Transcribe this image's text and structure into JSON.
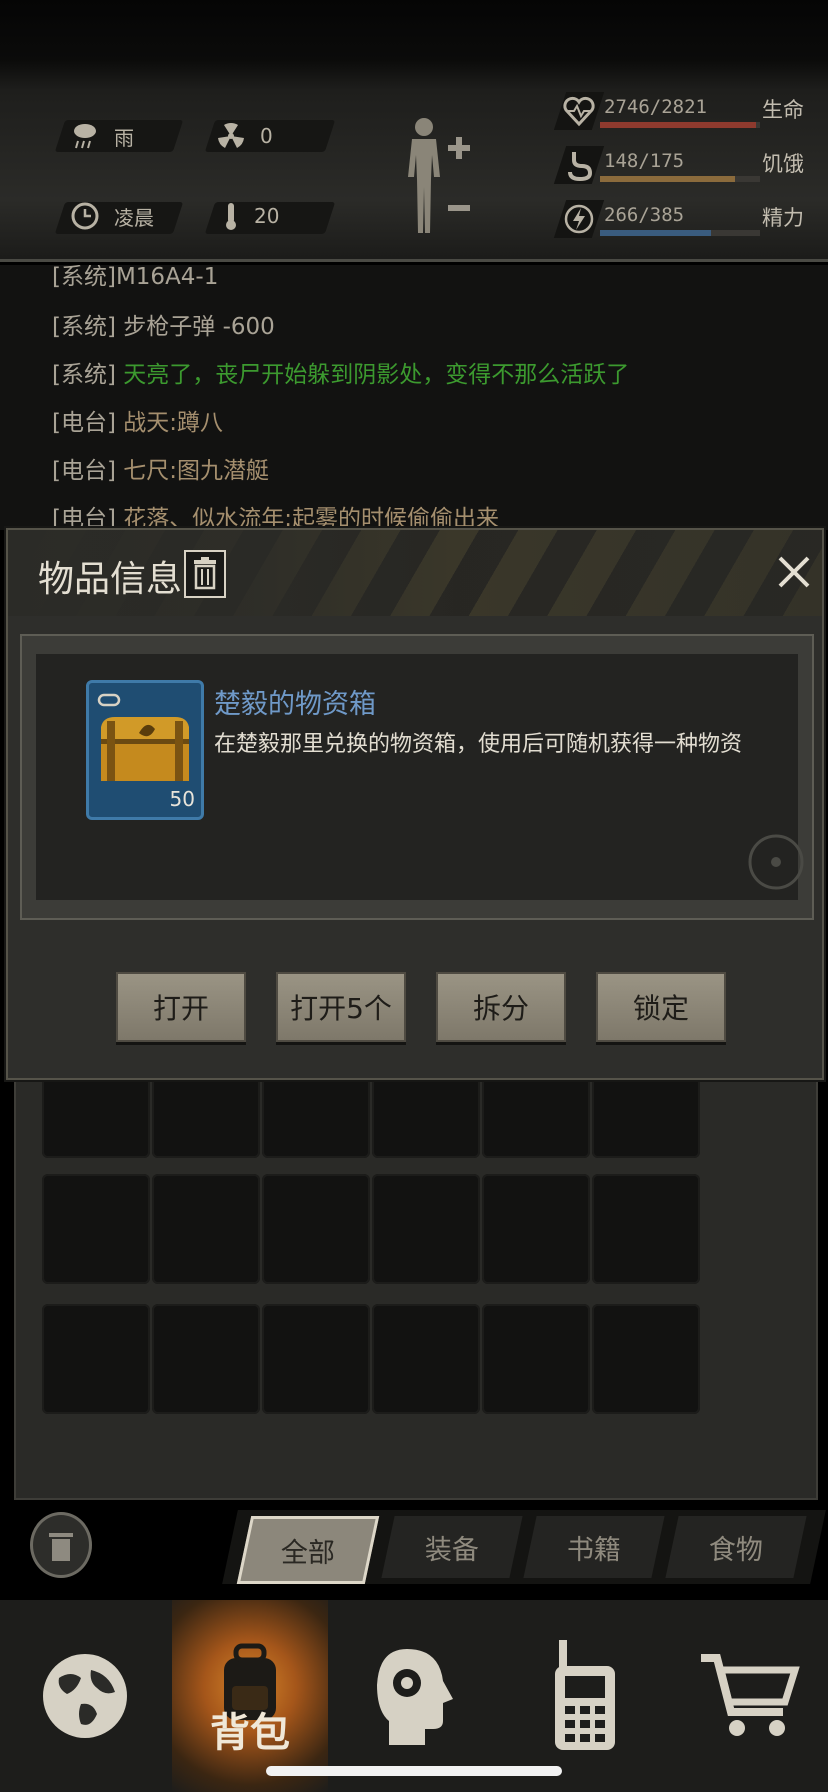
{
  "status": {
    "weather": "雨",
    "radiation": "0",
    "time_of_day": "凌晨",
    "temperature": "20",
    "health": {
      "value": "2746/2821",
      "label": "生命",
      "fraction": 0.973,
      "color": "#8e3a2e"
    },
    "hunger": {
      "value": "148/175",
      "label": "饥饿",
      "fraction": 0.846,
      "color": "#8b6b3c"
    },
    "energy": {
      "value": "266/385",
      "label": "精力",
      "fraction": 0.691,
      "color": "#3a5c7e"
    }
  },
  "log": {
    "lines": [
      {
        "tag": "[系统]",
        "text": "M16A4-1",
        "color": "#a9a396"
      },
      {
        "tag": "[系统]",
        "text": "步枪子弹 -600",
        "color": "#a9a396"
      },
      {
        "tag": "[系统]",
        "text": "天亮了，丧尸开始躲到阴影处，变得不那么活跃了",
        "color": "#3c9a2f"
      },
      {
        "tag": "[电台]",
        "text": "战天:蹲八",
        "color": "#a58f6e"
      },
      {
        "tag": "[电台]",
        "text": "七尺:图九潜艇",
        "color": "#a58f6e"
      },
      {
        "tag": "[电台]",
        "text": "花落、似水流年:起雾的时候偷偷出来",
        "color": "#a58f6e"
      }
    ]
  },
  "popup": {
    "title": "物品信息",
    "item_name": "楚毅的物资箱",
    "item_desc": "在楚毅那里兑换的物资箱，使用后可随机获得一种物资",
    "item_count": "50",
    "buttons": {
      "open": "打开",
      "open5": "打开5个",
      "split": "拆分",
      "lock": "锁定"
    },
    "name_color": "#6f99c8"
  },
  "tabs": [
    "全部",
    "装备",
    "书籍",
    "食物"
  ],
  "nav": {
    "backpack_label": "背包",
    "icons": [
      "globe-icon",
      "backpack-icon",
      "head-gear-icon",
      "radio-icon",
      "cart-icon"
    ]
  }
}
